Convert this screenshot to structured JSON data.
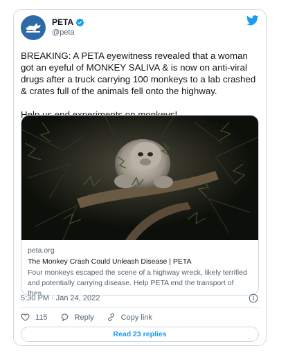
{
  "tweet": {
    "author": {
      "display_name": "PETA",
      "handle": "@peta",
      "verified": true,
      "avatar_icon": "peta-bunny-logo"
    },
    "platform_icon": "twitter-bird-icon",
    "text_paragraphs": [
      "BREAKING: A PETA eyewitness revealed that a woman got an eyeful of MONKEY SALIVA & is now on anti-viral drugs after a truck carrying 100 monkeys to a lab crashed & crates full of the animals fell onto the highway.",
      "Help us end experiments on monkeys!"
    ],
    "link_card": {
      "image_alt": "monkey in tree branches",
      "domain": "peta.org",
      "title": "The Monkey Crash Could Unleash Disease | PETA",
      "description": "Four monkeys escaped the scene of a highway wreck, likely terrified and potentially carrying disease. Help PETA end the transport of thes…"
    },
    "timestamp": "5:30 PM · Jan 24, 2022",
    "actions": {
      "like_count": "115",
      "reply_label": "Reply",
      "copy_link_label": "Copy link"
    },
    "read_replies_label": "Read 23 replies"
  },
  "colors": {
    "accent": "#1d9bf0",
    "avatar_bg": "#2d6aa7",
    "secondary_text": "#536471",
    "border": "#cfd9de"
  }
}
